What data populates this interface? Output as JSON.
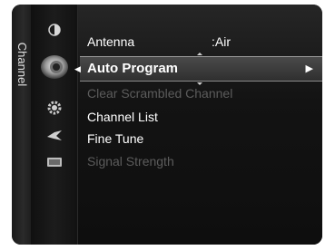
{
  "tab": {
    "label": "Channel"
  },
  "icons": [
    {
      "name": "picture-icon",
      "glyph": "◐"
    },
    {
      "name": "channel-icon",
      "glyph": "◉"
    },
    {
      "name": "setup-icon",
      "glyph": "✿"
    },
    {
      "name": "input-icon",
      "glyph": "✚"
    },
    {
      "name": "application-icon",
      "glyph": "▰"
    }
  ],
  "menu": {
    "antenna": {
      "label": "Antenna",
      "value": ":Air"
    },
    "selected": {
      "label": "Auto Program",
      "arrow": "▶"
    },
    "items": [
      {
        "label": "Clear Scrambled Channel",
        "enabled": false
      },
      {
        "label": "Channel List",
        "enabled": true
      },
      {
        "label": "Fine Tune",
        "enabled": true
      },
      {
        "label": "Signal Strength",
        "enabled": false
      }
    ]
  }
}
